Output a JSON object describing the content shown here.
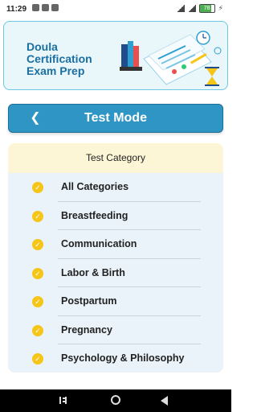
{
  "status_bar": {
    "time": "11:29",
    "battery": "78"
  },
  "banner": {
    "title": "Doula Certification Exam Prep"
  },
  "header": {
    "back_icon": "chevron-left-icon",
    "title": "Test Mode"
  },
  "category_card": {
    "heading": "Test Category",
    "check_color": "#f5c518",
    "items": [
      {
        "label": "All Categories"
      },
      {
        "label": "Breastfeeding"
      },
      {
        "label": "Communication"
      },
      {
        "label": "Labor & Birth"
      },
      {
        "label": "Postpartum"
      },
      {
        "label": "Pregnancy"
      },
      {
        "label": "Psychology & Philosophy"
      }
    ]
  },
  "colors": {
    "accent": "#2f95c4",
    "banner_text": "#1b6ea0",
    "card_bg": "#eaf3f9",
    "card_header_bg": "#fdf6d6"
  }
}
